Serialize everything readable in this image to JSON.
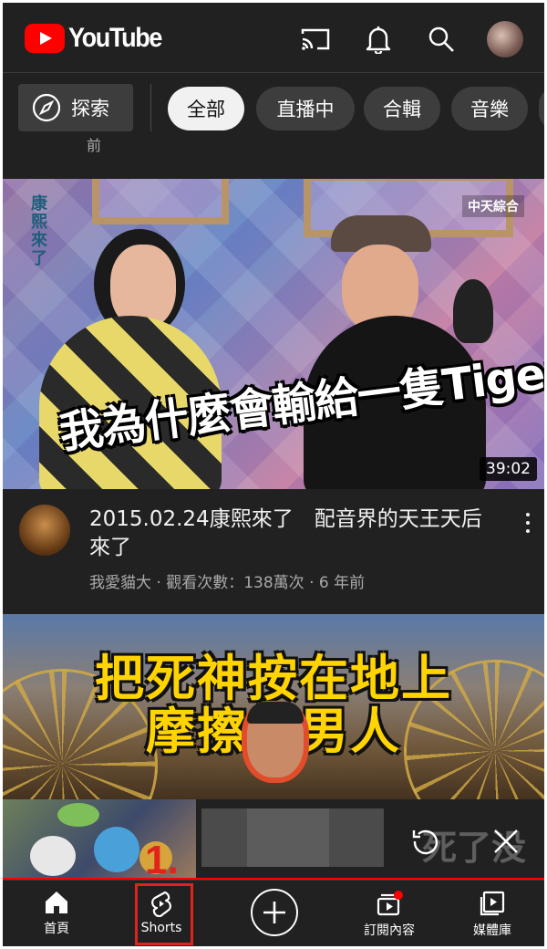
{
  "header": {
    "logo_text": "YouTube",
    "icons": [
      "cast-icon",
      "bell-icon",
      "search-icon",
      "avatar"
    ]
  },
  "chips": {
    "explore_label": "探索",
    "items": [
      "全部",
      "直播中",
      "合輯",
      "音樂"
    ],
    "selected": "全部"
  },
  "feed": {
    "previous_item_time_fragment": "前",
    "video1": {
      "thumbnail": {
        "show_label": "康熙來了",
        "channel_logo": "中天綜合",
        "caption": "我為什麼會輸給一隻Tiger",
        "duration": "39:02"
      },
      "title": "2015.02.24康熙來了　配音界的天王天后來了",
      "channel": "我愛貓大",
      "views": "觀看次數：138萬次",
      "age": "6 年前",
      "meta_separator": "·"
    },
    "video2": {
      "thumbnail": {
        "caption_line1": "把死神按在地上",
        "caption_line2": "摩擦的男人"
      }
    }
  },
  "miniplayer": {
    "obscured_text": "死了没",
    "icons": [
      "replay-icon",
      "close-icon"
    ]
  },
  "annotation": {
    "step_label": "1.",
    "highlight_color": "#e0241b"
  },
  "bottom_nav": {
    "items": [
      {
        "label": "首頁",
        "icon": "home-icon"
      },
      {
        "label": "Shorts",
        "icon": "shorts-icon"
      },
      {
        "label": "",
        "icon": "add-icon"
      },
      {
        "label": "訂閱內容",
        "icon": "subscriptions-icon"
      },
      {
        "label": "媒體庫",
        "icon": "library-icon"
      }
    ]
  },
  "colors": {
    "background": "#212121",
    "accent_red": "#ff0000",
    "chip_bg": "#3d3d3d",
    "chip_active_bg": "#f1f1f1",
    "secondary_text": "#aaaaaa",
    "caption_yellow": "#ffd400"
  }
}
